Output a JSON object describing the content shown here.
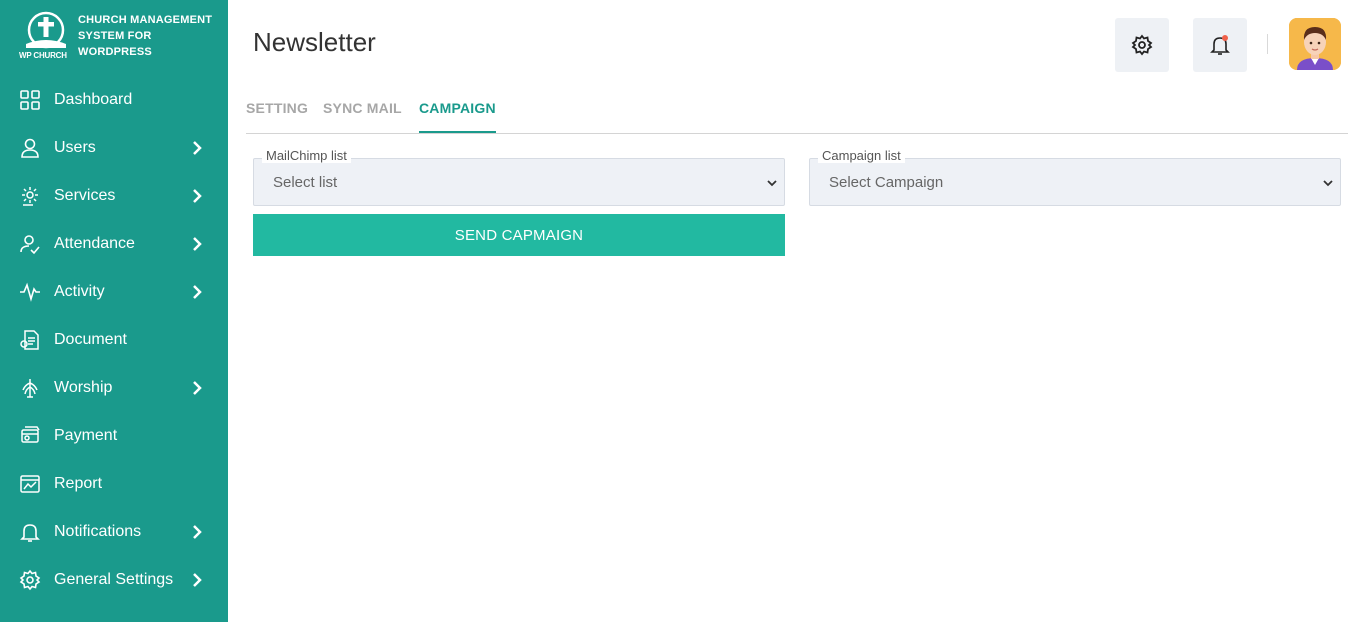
{
  "brand": {
    "line1": "CHURCH MANAGEMENT",
    "line2": "SYSTEM FOR",
    "line3": "WORDPRESS",
    "mark_text": "WP CHURCH"
  },
  "sidebar": {
    "items": [
      {
        "label": "Dashboard",
        "icon": "dashboard-icon",
        "chevron": false
      },
      {
        "label": "Users",
        "icon": "user-icon",
        "chevron": true
      },
      {
        "label": "Services",
        "icon": "services-icon",
        "chevron": true
      },
      {
        "label": "Attendance",
        "icon": "attendance-icon",
        "chevron": true
      },
      {
        "label": "Activity",
        "icon": "activity-icon",
        "chevron": true
      },
      {
        "label": "Document",
        "icon": "document-icon",
        "chevron": false
      },
      {
        "label": "Worship",
        "icon": "worship-icon",
        "chevron": true
      },
      {
        "label": "Payment",
        "icon": "payment-icon",
        "chevron": false
      },
      {
        "label": "Report",
        "icon": "report-icon",
        "chevron": false
      },
      {
        "label": "Notifications",
        "icon": "bell-icon",
        "chevron": true
      },
      {
        "label": "General Settings",
        "icon": "gear-icon",
        "chevron": true
      }
    ]
  },
  "header": {
    "title": "Newsletter"
  },
  "tabs": [
    {
      "label": "SETTING",
      "active": false
    },
    {
      "label": "SYNC MAIL",
      "active": false
    },
    {
      "label": "CAMPAIGN",
      "active": true
    }
  ],
  "form": {
    "mailchimp_label": "MailChimp list",
    "mailchimp_value": "Select list",
    "campaign_label": "Campaign list",
    "campaign_value": "Select Campaign",
    "send_label": "SEND CAPMAIGN"
  },
  "colors": {
    "sidebar": "#1a9a8c",
    "accent": "#22b9a1",
    "notification_dot": "#f0614a"
  }
}
